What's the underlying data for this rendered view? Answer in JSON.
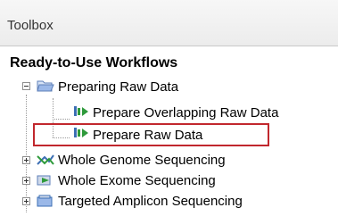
{
  "panel": {
    "title": "Toolbox"
  },
  "section": {
    "title": "Ready-to-Use Workflows"
  },
  "tree": {
    "folder": {
      "label": "Preparing Raw Data"
    },
    "children": [
      {
        "label": "Prepare Overlapping Raw Data"
      },
      {
        "label": "Prepare Raw Data"
      }
    ],
    "siblings": [
      {
        "label": "Whole Genome Sequencing"
      },
      {
        "label": "Whole Exome Sequencing"
      },
      {
        "label": "Targeted Amplicon Sequencing"
      }
    ]
  },
  "colors": {
    "highlight": "#c1272d",
    "folder": "#7f9fd6",
    "workflow_green": "#2e9a3b",
    "workflow_blue": "#3c6fb4"
  },
  "icons": [
    "folder-open-icon",
    "workflow-icon",
    "genome-icon",
    "exome-icon",
    "amplicon-icon"
  ]
}
